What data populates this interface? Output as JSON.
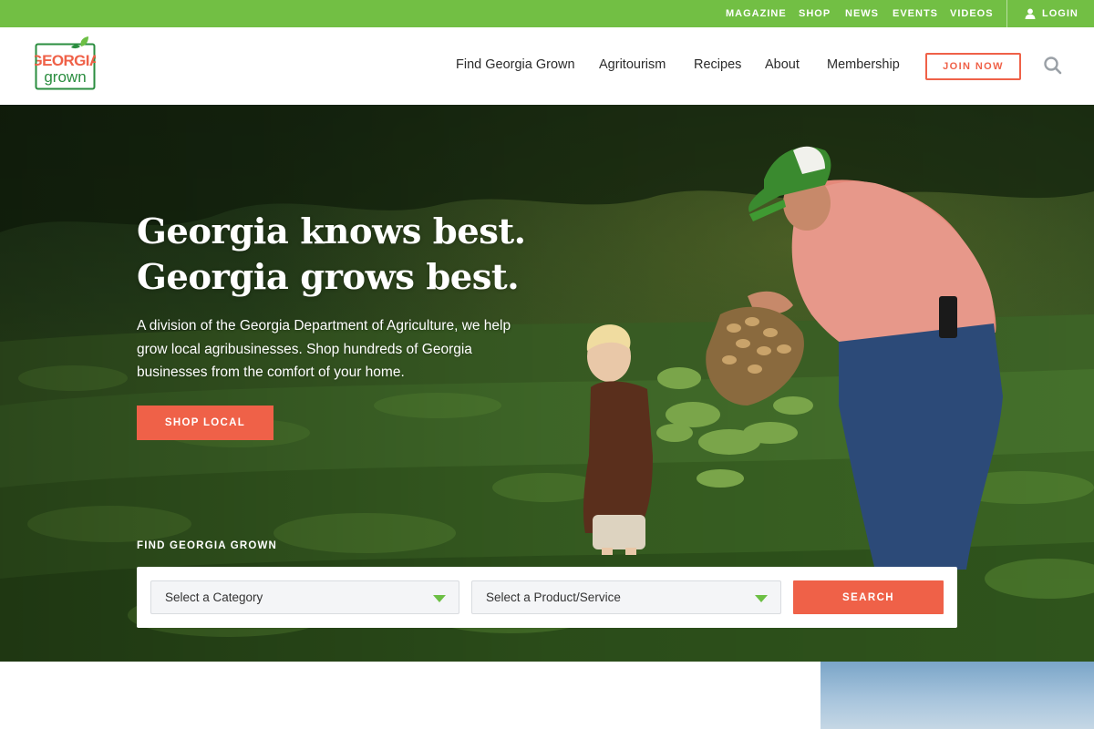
{
  "utility_nav": {
    "links": [
      "MAGAZINE",
      "SHOP",
      "NEWS",
      "EVENTS",
      "VIDEOS"
    ],
    "login_label": "LOGIN",
    "login_icon": "user-icon",
    "background_color": "#72bf44"
  },
  "header": {
    "logo": {
      "line1": "GEORGIA",
      "line2": "grown"
    },
    "nav_items": [
      "Find Georgia Grown",
      "Agritourism",
      "Recipes",
      "About",
      "Membership"
    ],
    "join_label": "JOIN NOW",
    "search_icon": "search-icon",
    "accent_color": "#ef6148"
  },
  "hero": {
    "title_line1": "Georgia knows best.",
    "title_line2": "Georgia grows best.",
    "description": "A division of the Georgia Department of Agriculture, we help grow local agribusinesses. Shop hundreds of Georgia businesses from the comfort of your home.",
    "cta_label": "SHOP LOCAL",
    "image_subject": "farmer-and-child-in-peanut-field"
  },
  "finder": {
    "label": "FIND GEORGIA GROWN",
    "category_select": "Select a Category",
    "product_select": "Select a Product/Service",
    "search_label": "SEARCH"
  }
}
